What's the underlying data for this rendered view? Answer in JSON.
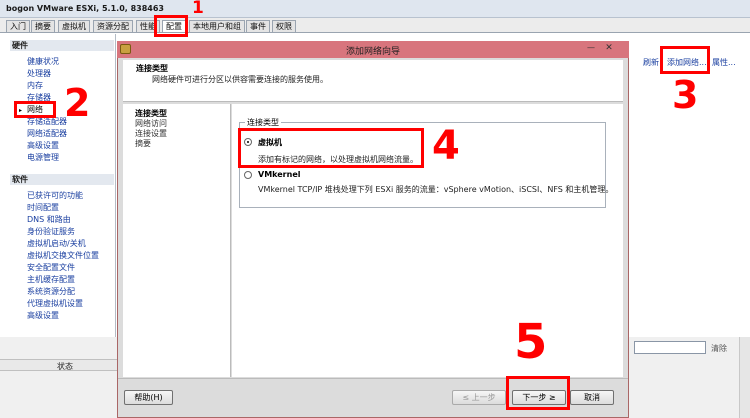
{
  "app": {
    "title": "bogon VMware ESXi, 5.1.0, 838463"
  },
  "tabs": [
    {
      "label": "入门"
    },
    {
      "label": "摘要"
    },
    {
      "label": "虚拟机"
    },
    {
      "label": "资源分配"
    },
    {
      "label": "性能"
    },
    {
      "label": "配置"
    },
    {
      "label": "本地用户和组"
    },
    {
      "label": "事件"
    },
    {
      "label": "权限"
    }
  ],
  "sidebar": {
    "hardware_header": "硬件",
    "hardware_items": [
      {
        "label": "健康状况"
      },
      {
        "label": "处理器"
      },
      {
        "label": "内存"
      },
      {
        "label": "存储器"
      },
      {
        "label": "网络"
      },
      {
        "label": "存储适配器"
      },
      {
        "label": "网络适配器"
      },
      {
        "label": "高级设置"
      },
      {
        "label": "电源管理"
      }
    ],
    "software_header": "软件",
    "software_items": [
      {
        "label": "已获许可的功能"
      },
      {
        "label": "时间配置"
      },
      {
        "label": "DNS 和路由"
      },
      {
        "label": "身份验证服务"
      },
      {
        "label": "虚拟机启动/关机"
      },
      {
        "label": "虚拟机交换文件位置"
      },
      {
        "label": "安全配置文件"
      },
      {
        "label": "主机缓存配置"
      },
      {
        "label": "系统资源分配"
      },
      {
        "label": "代理虚拟机设置"
      },
      {
        "label": "高级设置"
      }
    ],
    "selected_arrow": "▸"
  },
  "toolbar_links": {
    "refresh": "刷新",
    "add_network": "添加网络...",
    "properties": "属性..."
  },
  "bottom": {
    "clear_label": "清除",
    "status_label": "状态"
  },
  "dialog": {
    "title": "添加网络向导",
    "min_glyph": "—",
    "close_glyph": "✕",
    "header_title": "连接类型",
    "header_desc": "网络硬件可进行分区以供容需要连接的服务使用。",
    "steps": [
      {
        "label": "连接类型",
        "state": "current"
      },
      {
        "label": "网络访问",
        "state": "pending"
      },
      {
        "label": "连接设置",
        "state": "pending"
      },
      {
        "label": "摘要",
        "state": "pending"
      }
    ],
    "group_legend": "连接类型",
    "options": [
      {
        "label": "虚拟机",
        "desc": "添加有标记的网络，以处理虚拟机网络流量。",
        "checked": true
      },
      {
        "label": "VMkernel",
        "desc": "VMkernel TCP/IP 堆栈处理下列 ESXi 服务的流量：vSphere vMotion、iSCSI、NFS 和主机管理。",
        "checked": false
      }
    ],
    "buttons": {
      "help": "帮助(H)",
      "back": "≤ 上一步",
      "next": "下一步 ≥",
      "cancel": "取消"
    }
  },
  "annotations": [
    {
      "number": "1"
    },
    {
      "number": "2"
    },
    {
      "number": "3"
    },
    {
      "number": "4"
    },
    {
      "number": "5"
    }
  ],
  "colors": {
    "annotation": "#ff0000",
    "dialog_title": "#d8757d",
    "link": "#1a3fa0"
  }
}
